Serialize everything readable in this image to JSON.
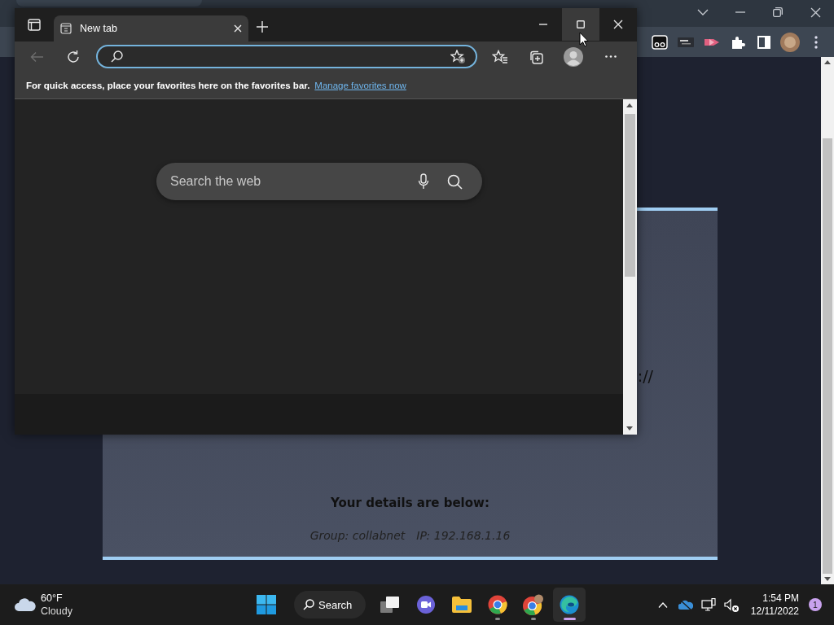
{
  "background_window": {
    "page": {
      "url_fragment": "://",
      "details_heading": "Your details are below:",
      "group": "Group: collabnet",
      "ip": "IP: 192.168.1.16"
    }
  },
  "edge_window": {
    "tabs": [
      {
        "label": "New tab",
        "selected": true
      }
    ],
    "back_button": {
      "disabled": true
    },
    "favorites_bar": {
      "message": "For quick access, place your favorites here on the favorites bar.",
      "link": "Manage favorites now"
    },
    "search_box": {
      "placeholder": "Search the web"
    }
  },
  "taskbar": {
    "weather": {
      "temperature": "60°F",
      "condition": "Cloudy"
    },
    "apps": [
      {
        "kind": "start",
        "running": false,
        "selected": false
      },
      {
        "kind": "search",
        "label": "Search"
      },
      {
        "kind": "task-view",
        "running": false,
        "selected": false
      },
      {
        "kind": "meet",
        "running": false,
        "selected": false
      },
      {
        "kind": "explorer",
        "running": false,
        "selected": false
      },
      {
        "kind": "chrome",
        "running": true,
        "selected": false
      },
      {
        "kind": "chrome-profile",
        "running": true,
        "selected": false
      },
      {
        "kind": "edge",
        "running": true,
        "selected": true
      }
    ],
    "tray": {
      "volume_muted": true
    },
    "clock": {
      "time": "1:54 PM",
      "date": "12/11/2022"
    },
    "notifications": "1"
  }
}
